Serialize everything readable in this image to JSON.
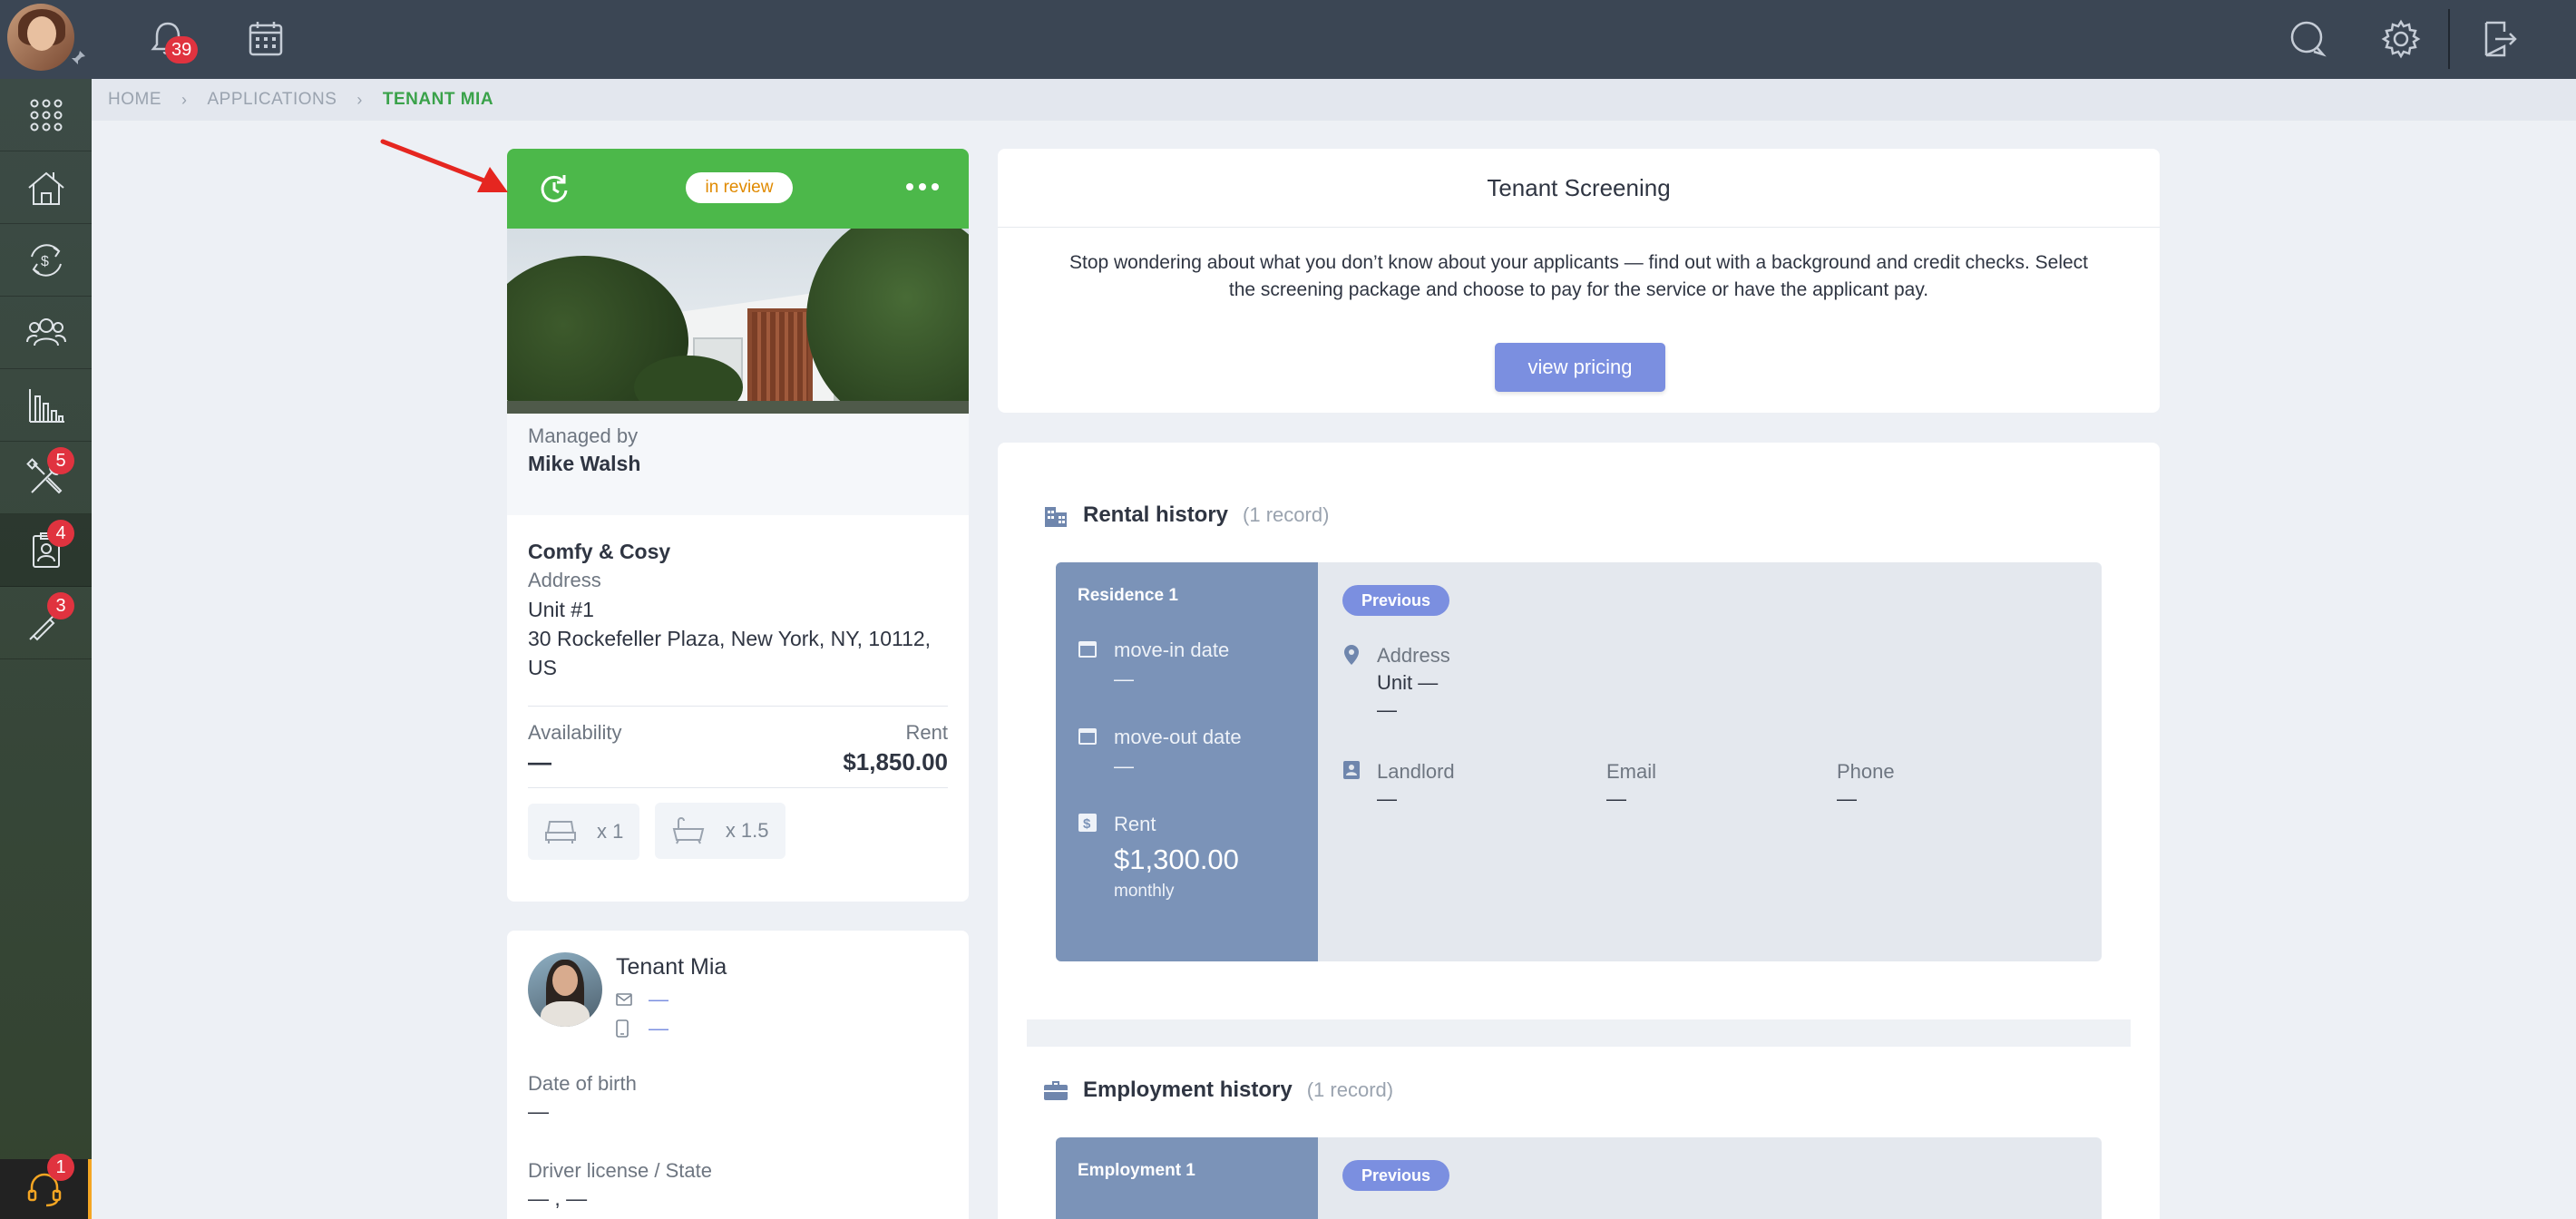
{
  "topbar": {
    "notifications_count": "39"
  },
  "sidebar": {
    "items": [
      {
        "name": "apps",
        "badge": null
      },
      {
        "name": "properties",
        "badge": null
      },
      {
        "name": "accounting",
        "badge": null
      },
      {
        "name": "people",
        "badge": null
      },
      {
        "name": "reports",
        "badge": null
      },
      {
        "name": "maintenance",
        "badge": "5"
      },
      {
        "name": "applications",
        "badge": "4"
      },
      {
        "name": "tools",
        "badge": "3"
      }
    ],
    "support_badge": "1"
  },
  "breadcrumb": {
    "home": "HOME",
    "applications": "APPLICATIONS",
    "current": "TENANT MIA"
  },
  "property": {
    "status": "in review",
    "managed_by_label": "Managed by",
    "manager": "Mike Walsh",
    "name": "Comfy & Cosy",
    "address_label": "Address",
    "unit": "Unit #1",
    "street": "30 Rockefeller Plaza, New York, NY, 10112,",
    "country": "US",
    "availability_label": "Availability",
    "availability": "—",
    "rent_label": "Rent",
    "rent": "$1,850.00",
    "beds": "x 1",
    "baths": "x 1.5"
  },
  "tenant": {
    "name": "Tenant Mia",
    "email": "—",
    "phone": "—",
    "dob_label": "Date of birth",
    "dob": "—",
    "license_label": "Driver license / State",
    "license": "— , —"
  },
  "screening": {
    "title": "Tenant Screening",
    "text_line1": "Stop wondering about what you don’t know about your applicants — find out with a background and credit checks. Select",
    "text_line2": "the screening package and choose to pay for the service or have the applicant pay.",
    "button": "view pricing"
  },
  "rental_history": {
    "title": "Rental history",
    "count": "(1 record)",
    "residence_title": "Residence 1",
    "move_in_label": "move-in date",
    "move_in": "—",
    "move_out_label": "move-out date",
    "move_out": "—",
    "rent_label": "Rent",
    "rent": "$1,300.00",
    "rent_period": "monthly",
    "status": "Previous",
    "address_label": "Address",
    "unit": "Unit —",
    "address": "—",
    "landlord_label": "Landlord",
    "landlord": "—",
    "email_label": "Email",
    "email": "—",
    "phone_label": "Phone",
    "phone": "—"
  },
  "employment_history": {
    "title": "Employment history",
    "count": "(1 record)",
    "employment_title": "Employment 1",
    "status": "Previous"
  },
  "colors": {
    "header_green": "#4cb84a",
    "accent_blue": "#7b8fe0",
    "residence_blue": "#7b93b8",
    "badge_red": "#e0333f",
    "topbar": "#3b4654"
  }
}
